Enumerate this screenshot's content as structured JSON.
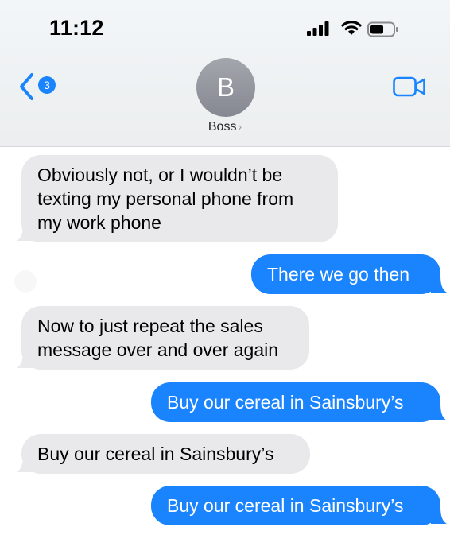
{
  "status_bar": {
    "time": "11:12"
  },
  "header": {
    "back_badge": "3",
    "avatar_initial": "B",
    "contact_name": "Boss",
    "contact_chevron": "›"
  },
  "icons": {
    "back": "chevron-left-icon",
    "video": "video-camera-icon",
    "signal": "cellular-signal-icon",
    "wifi": "wifi-icon",
    "battery": "battery-icon"
  },
  "colors": {
    "sent": "#1a84ff",
    "received": "#e9e9eb"
  },
  "messages": [
    {
      "direction": "received",
      "lines": [
        "Obviously not, or I wouldn’t be",
        "texting my personal phone from",
        "my work phone"
      ]
    },
    {
      "direction": "sent",
      "lines": [
        "There we go then"
      ]
    },
    {
      "direction": "received",
      "lines": [
        "Now to just repeat the sales",
        "message over and over again"
      ]
    },
    {
      "direction": "sent",
      "lines": [
        "Buy our cereal in Sainsbury’s"
      ]
    },
    {
      "direction": "received",
      "lines": [
        "Buy our cereal in Sainsbury’s"
      ]
    },
    {
      "direction": "sent",
      "lines": [
        "Buy our cereal in Sainsbury’s"
      ]
    }
  ]
}
